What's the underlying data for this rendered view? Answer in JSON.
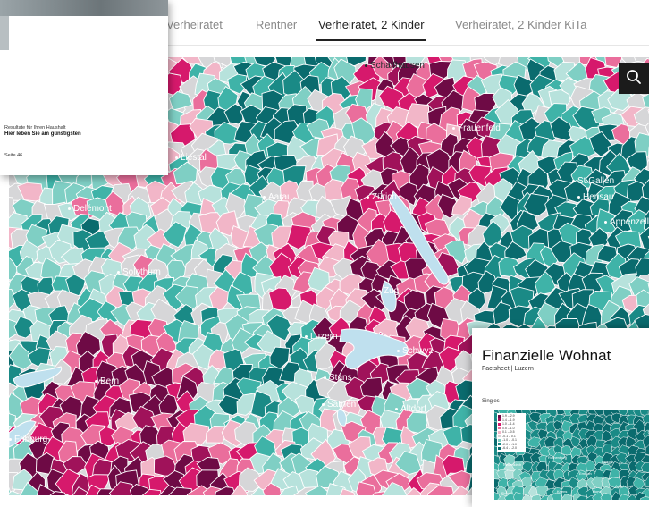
{
  "tabs": [
    {
      "label": "Verheiratet",
      "active": false
    },
    {
      "label": "Rentner",
      "active": false
    },
    {
      "label": "Verheiratet, 2 Kinder",
      "active": true
    },
    {
      "label": "Verheiratet, 2 Kinder KiTa",
      "active": false
    }
  ],
  "map": {
    "palette": [
      "#0a6b6e",
      "#1a8a86",
      "#3fb3a8",
      "#7fcfc4",
      "#b7e2dc",
      "#d6d6d8",
      "#f2b6c8",
      "#ea6e9c",
      "#d6196c",
      "#a0125a",
      "#6e0a45"
    ],
    "cities": [
      "Schaffhausen",
      "Frauenfeld",
      "St.Gallen",
      "Herisau",
      "Appenzell",
      "Liestal",
      "Delémont",
      "Aarau",
      "Zürich",
      "Solothurn",
      "Zug",
      "Luzern",
      "Schwyz",
      "Stans",
      "Sarnen",
      "Altdorf",
      "Bern",
      "Fribourg"
    ],
    "lakes": [
      "lake-zurich",
      "lake-zug",
      "lake-lucerne",
      "lake-sarnen",
      "lake-biel",
      "lake-neuchatel"
    ]
  },
  "search": {
    "icon": "search-icon"
  },
  "report": {
    "subtitle": "Resultate für Ihren Haushalt",
    "heading": "Hier leben Sie am günstigsten",
    "page": "Seite 46"
  },
  "factsheet": {
    "title": "Finanzielle Wohnat",
    "subtitle": "Factsheet | Luzern",
    "section": "Singles",
    "legend": [
      "1.9 – 2.9",
      "1.4 – 1.9",
      "1.0 – 1.4",
      "0.5 – 1.0",
      "0.1 – 0.5",
      "-0.1 – 0.1",
      "-1.0 – -0.1",
      "-2.0 – -1.0",
      "-6.4 – -2.0"
    ],
    "legend_colors": [
      "#6e0a45",
      "#a0125a",
      "#d6196c",
      "#ea6e9c",
      "#f2b6c8",
      "#d6d6d8",
      "#7fcfc4",
      "#1a8a86",
      "#0a6b6e"
    ],
    "places": [
      "Neuenkirch",
      "Rothenburg",
      "Ebikon",
      "Emmen",
      "Adligenswil",
      "Horw",
      "Kriens",
      "Ruswil"
    ]
  }
}
